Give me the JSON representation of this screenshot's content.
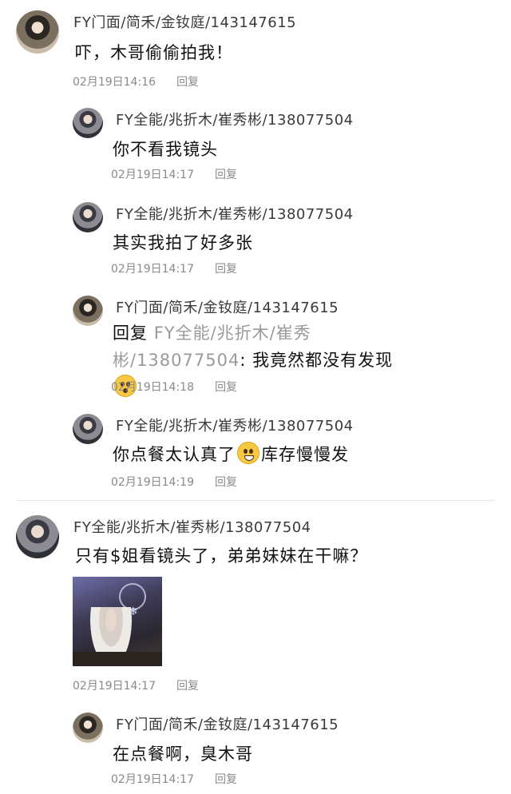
{
  "comments": [
    {
      "author": "FY门面/简禾/金钕庭/143147615",
      "text": "吓，木哥偷偷拍我！",
      "date": "02月19日14:16",
      "reply_label": "回复"
    },
    {
      "author": "FY全能/兆折木/崔秀彬/138077504",
      "text": "你不看我镜头",
      "date": "02月19日14:17",
      "reply_label": "回复"
    },
    {
      "author": "FY全能/兆折木/崔秀彬/138077504",
      "text": "其实我拍了好多张",
      "date": "02月19日14:17",
      "reply_label": "回复"
    },
    {
      "author": "FY门面/简禾/金钕庭/143147615",
      "reply_prefix": "回复 ",
      "reply_to": "FY全能/兆折木/崔秀彬/138077504",
      "text": ": 我竟然都没有发现",
      "date": "02月19日14:18",
      "reply_label": "回复"
    },
    {
      "author": "FY全能/兆折木/崔秀彬/138077504",
      "text_before": "你点餐太认真了",
      "text_after": "库存慢慢发",
      "date": "02月19日14:19",
      "reply_label": "回复"
    },
    {
      "author": "FY全能/兆折木/崔秀彬/138077504",
      "text": "只有$姐看镜头了，弟弟妹妹在干嘛？",
      "date": "02月19日14:17",
      "reply_label": "回复"
    },
    {
      "author": "FY门面/简禾/金钕庭/143147615",
      "text": "在点餐啊，臭木哥",
      "date": "02月19日14:17",
      "reply_label": "回复"
    }
  ],
  "emojis": {
    "shock": "shocked-face-emoji",
    "grin": "grinning-face-emoji"
  }
}
